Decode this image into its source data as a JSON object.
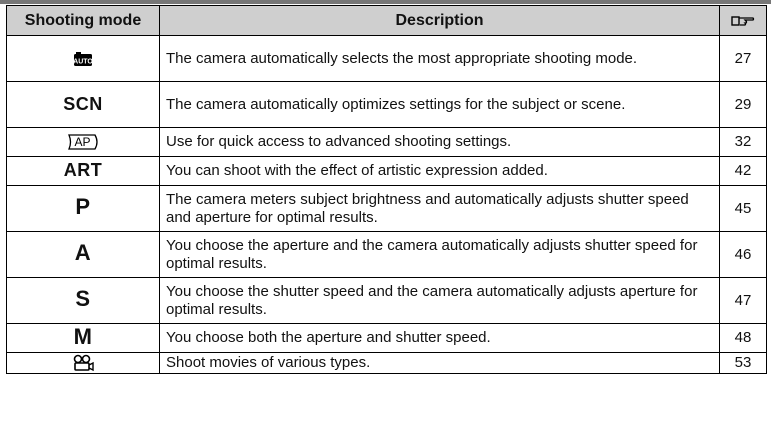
{
  "header": {
    "mode": "Shooting mode",
    "description": "Description",
    "page_icon": "page-reference-hand-icon"
  },
  "rows": [
    {
      "mode_icon": "auto-camera-icon",
      "description": "The camera automatically selects the most appropriate shooting mode.",
      "page": "27"
    },
    {
      "mode": "SCN",
      "description": "The camera automatically optimizes settings for the subject or scene.",
      "page": "29"
    },
    {
      "mode_icon": "ap-advanced-photo-icon",
      "mode_icon_text": "AP",
      "description": "Use for quick access to advanced shooting settings.",
      "page": "32"
    },
    {
      "mode": "ART",
      "description": "You can shoot with the effect of artistic expression added.",
      "page": "42"
    },
    {
      "mode": "P",
      "description": "The camera meters subject brightness and automatically adjusts shutter speed and aperture for optimal results.",
      "page": "45"
    },
    {
      "mode": "A",
      "description": "You choose the aperture and the camera automatically adjusts shutter speed for optimal results.",
      "page": "46"
    },
    {
      "mode": "S",
      "description": "You choose the shutter speed and the camera automatically adjusts aperture for optimal results.",
      "page": "47"
    },
    {
      "mode": "M",
      "description": "You choose both the aperture and shutter speed.",
      "page": "48"
    },
    {
      "mode_icon": "movie-camera-icon",
      "description": "Shoot movies of various types.",
      "page": "53"
    }
  ]
}
